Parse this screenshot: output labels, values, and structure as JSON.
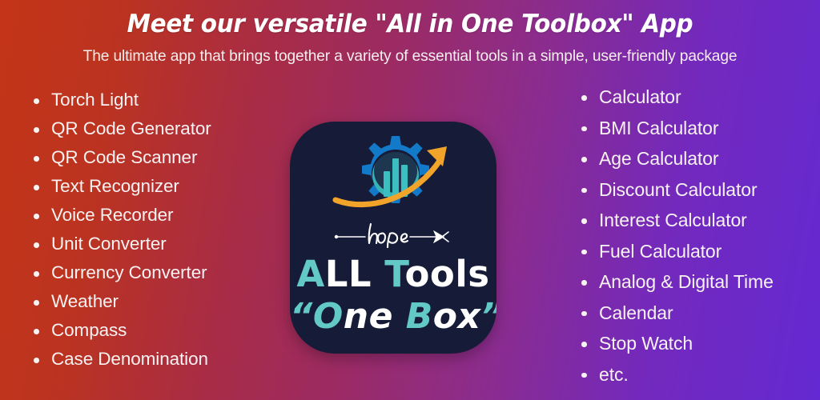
{
  "background": {
    "gradient_start": "#c43518",
    "gradient_mid": "#a62d52",
    "gradient_end": "#6429d2",
    "direction": "left-to-right"
  },
  "header": {
    "title": "Meet our versatile \"All in One Toolbox\" App",
    "subtitle": "The ultimate app that brings together a variety of essential tools in a simple, user-friendly package",
    "title_color": "#ffffff",
    "subtitle_color": "#f7eeee"
  },
  "left_column": {
    "items": [
      "Torch Light",
      "QR Code Generator",
      "QR Code Scanner",
      "Text Recognizer",
      "Voice Recorder",
      "Unit Converter",
      "Currency Converter",
      "Weather",
      "Compass",
      "Case Denomination"
    ]
  },
  "right_column": {
    "items": [
      "Calculator",
      "BMI Calculator",
      "Age Calculator",
      "Discount Calculator",
      "Interest Calculator",
      "Fuel Calculator",
      "Analog & Digital Time",
      "Calendar",
      "Stop Watch",
      "etc."
    ]
  },
  "app_icon": {
    "background_color": "#161c38",
    "gear_color": "#1379c9",
    "bars_color": "#3bbfc0",
    "circle_color": "#3bbfc0",
    "arrow_color": "#f2a32a",
    "script_word": "hope",
    "script_color": "#ffffff",
    "brand_line_1": {
      "part_a": "A",
      "part_b": "LL",
      "part_c": "T",
      "part_d": "ools"
    },
    "brand_line_2": {
      "quote_open": "“",
      "part_a": "O",
      "part_b": "ne",
      "part_c": "B",
      "part_d": "ox",
      "quote_close": "”"
    },
    "accent_color": "#62c9c6",
    "text_color": "#ffffff"
  }
}
